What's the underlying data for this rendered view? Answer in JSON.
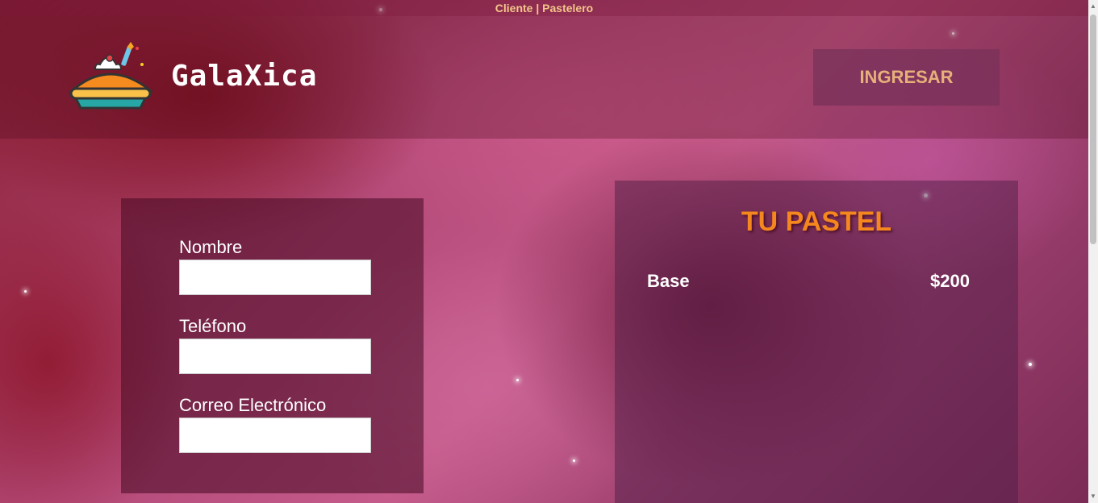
{
  "topbar": {
    "cliente": "Cliente",
    "separator": "|",
    "pastelero": "Pastelero"
  },
  "header": {
    "brand": "GalaXica",
    "login_label": "INGRESAR"
  },
  "form": {
    "fields": [
      {
        "label": "Nombre",
        "value": ""
      },
      {
        "label": "Teléfono",
        "value": ""
      },
      {
        "label": "Correo Electrónico",
        "value": ""
      }
    ]
  },
  "cake": {
    "title": "TU PASTEL",
    "items": [
      {
        "name": "Base",
        "price": "$200"
      }
    ]
  },
  "colors": {
    "accent": "#f5871f",
    "topbar_text": "#f3c58a",
    "button_text": "#e6b07a"
  }
}
